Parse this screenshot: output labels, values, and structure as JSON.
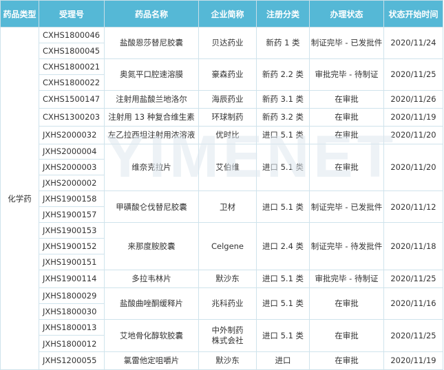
{
  "headers": {
    "drug_type": "药品类型",
    "acceptance_no": "受理号",
    "drug_name": "药品名称",
    "company": "企业简称",
    "registration": "注册分类",
    "status": "办理状态",
    "status_date": "状态开始时间"
  },
  "drug_type_value": "化学药",
  "ids": [
    "CXHS1800046",
    "CXHS1800045",
    "CXHS1800021",
    "CXHS1800022",
    "CXHS1500147",
    "CXHS1300203",
    "JXHS2000032",
    "JXHS2000004",
    "JXHS2000003",
    "JXHS2000002",
    "JXHS1900158",
    "JXHS1900157",
    "JXHS1900153",
    "JXHS1900152",
    "JXHS1900151",
    "JXHS1900114",
    "JXHS1800029",
    "JXHS1800030",
    "JXHS1800013",
    "JXHS1800012",
    "JXHS1200055"
  ],
  "groups": [
    {
      "name": "盐酸恩莎替尼胶囊",
      "company": "贝达药业",
      "registration": "新药 1 类",
      "status": "制证完毕 - 已发批件",
      "date": "2020/11/24"
    },
    {
      "name": "奥氮平口腔速溶膜",
      "company": "豪森药业",
      "registration": "新药 2.2 类",
      "status": "审批完毕 - 待制证",
      "date": "2020/11/25"
    },
    {
      "name": "注射用盐酸兰地洛尔",
      "company": "海辰药业",
      "registration": "新药 3.1 类",
      "status": "在审批",
      "date": "2020/11/26"
    },
    {
      "name": "注射用 13 种复合维生素",
      "company": "环球制药",
      "registration": "新药 3.2 类",
      "status": "在审批",
      "date": "2020/11/19"
    },
    {
      "name": "左乙拉西坦注射用浓溶液",
      "company": "优时比",
      "registration": "进口 5.1 类",
      "status": "在审批",
      "date": "2020/11/20"
    },
    {
      "name": "维奈克拉片",
      "company": "艾伯维",
      "registration": "进口 5.1 类",
      "status": "在审批",
      "date": "2020/11/20"
    },
    {
      "name": "甲磺酸仑伐替尼胶囊",
      "company": "卫材",
      "registration": "进口 5.1 类",
      "status": "制证完毕 - 已发批件",
      "date": "2020/11/12"
    },
    {
      "name": "来那度胺胶囊",
      "company": "Celgene",
      "registration": "进口 2.4 类",
      "status": "制证完毕 - 待发批件",
      "date": "2020/11/18"
    },
    {
      "name": "多拉韦林片",
      "company": "默沙东",
      "registration": "进口 5.1 类",
      "status": "审批完毕 - 待制证",
      "date": "2020/11/25"
    },
    {
      "name": "盐酸曲唑酮缓释片",
      "company": "兆科药业",
      "registration": "进口 5.1 类",
      "status": "在审批",
      "date": "2020/11/16"
    },
    {
      "name": "艾地骨化醇软胶囊",
      "company": "中外制药株式会社",
      "registration": "进口 5.1 类",
      "status": "在审批",
      "date": "2020/11/25"
    },
    {
      "name": "氯雷他定咀嚼片",
      "company": "默沙东",
      "registration": "进口",
      "status": "在审批",
      "date": "2020/11/19"
    }
  ],
  "watermark": "YIMENET"
}
